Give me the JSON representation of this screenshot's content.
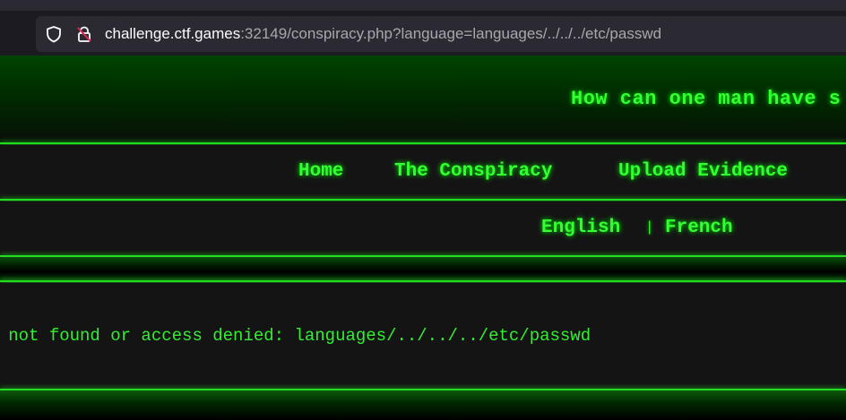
{
  "browser": {
    "url_domain": "challenge.ctf.games",
    "url_rest": ":32149/conspiracy.php?language=languages/../../../etc/passwd",
    "icons": [
      "shield-icon",
      "lock-off-icon"
    ]
  },
  "header": {
    "tagline": "How can one man have s"
  },
  "nav": {
    "items": [
      {
        "label": "Home"
      },
      {
        "label": "The Conspiracy"
      },
      {
        "label": "Upload Evidence"
      }
    ]
  },
  "languages": {
    "english": "English",
    "separator": "|",
    "french": "French"
  },
  "content": {
    "error": "le not found or access denied: languages/../../../etc/passwd"
  },
  "colors": {
    "accent": "#33ff33",
    "background": "#141414",
    "header_green": "#004400"
  }
}
